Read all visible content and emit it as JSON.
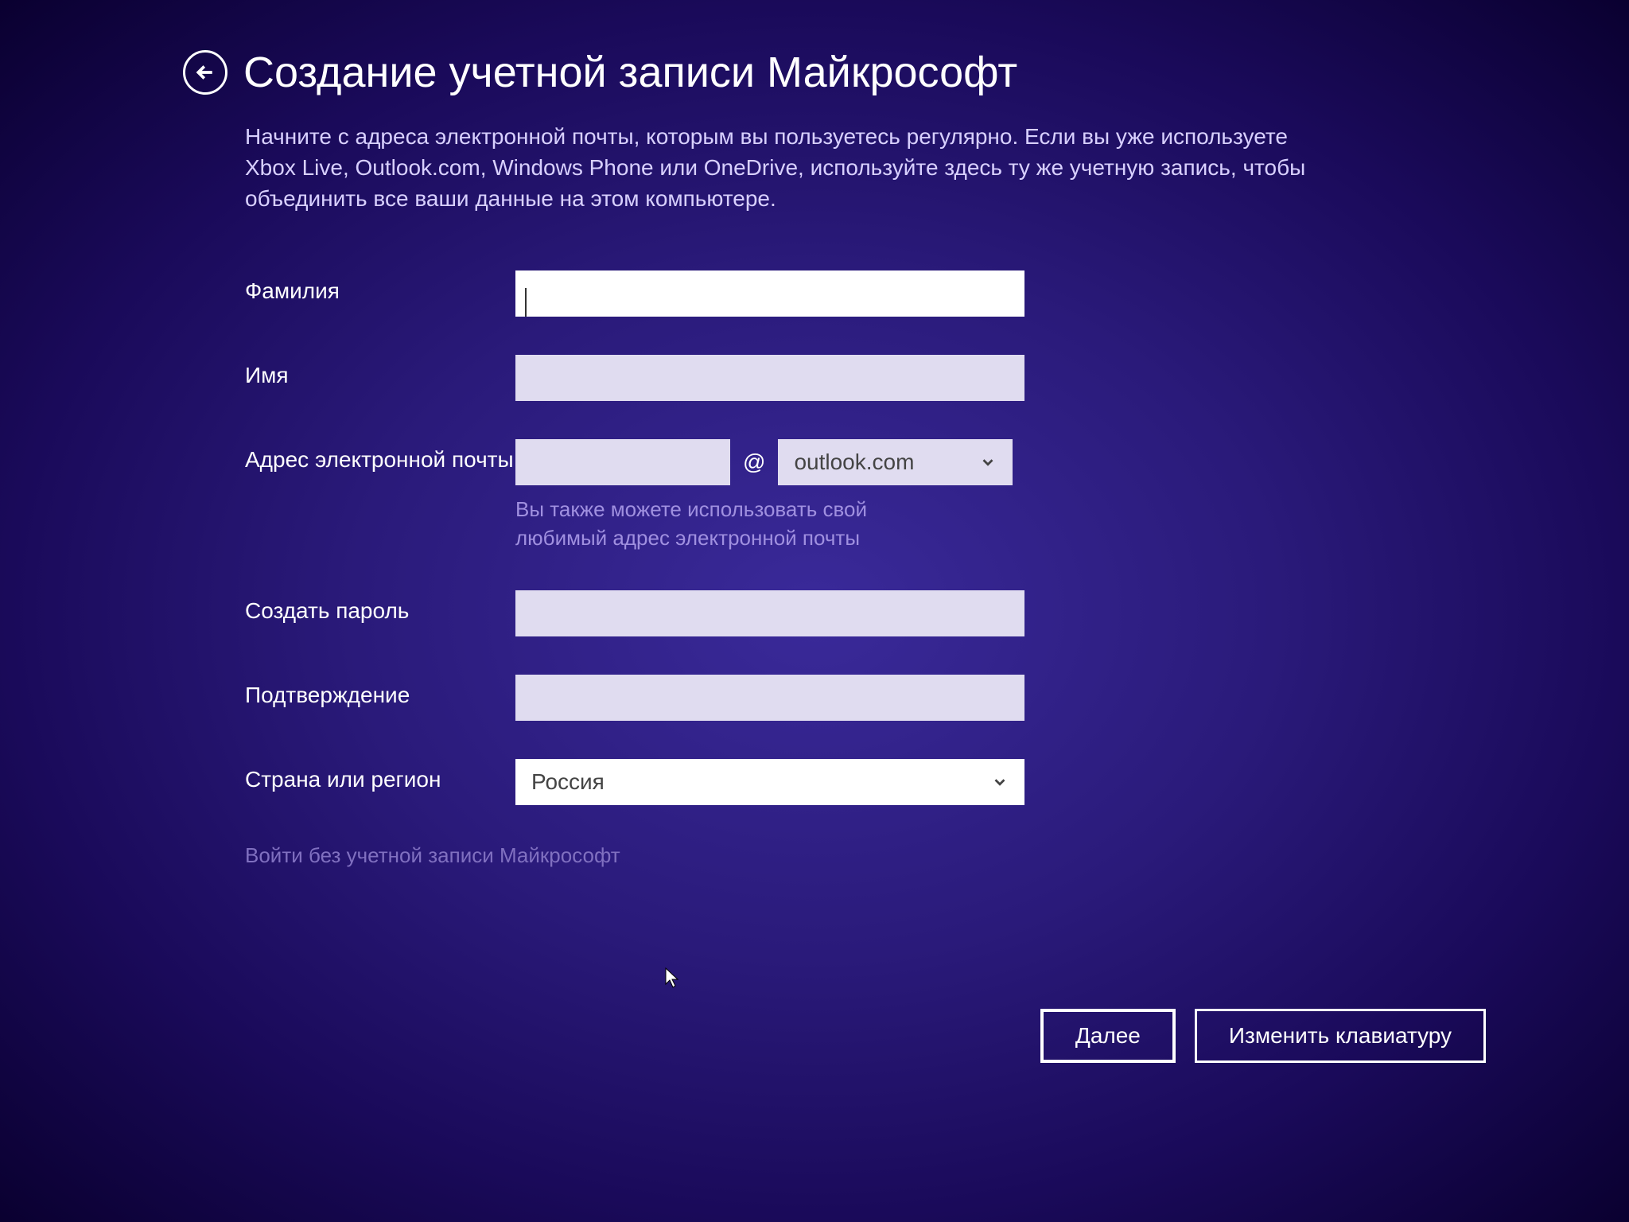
{
  "header": {
    "title": "Создание учетной записи Майкрософт"
  },
  "description": "Начните с адреса электронной почты, которым вы пользуетесь регулярно. Если вы уже используете Xbox Live, Outlook.com, Windows Phone или OneDrive, используйте здесь ту же учетную запись, чтобы объединить все ваши данные на этом компьютере.",
  "form": {
    "lastname": {
      "label": "Фамилия",
      "value": ""
    },
    "firstname": {
      "label": "Имя",
      "value": ""
    },
    "email": {
      "label": "Адрес электронной почты",
      "local_value": "",
      "at": "@",
      "domain_selected": "outlook.com",
      "helper": "Вы также можете использовать свой любимый адрес электронной почты"
    },
    "password": {
      "label": "Создать пароль",
      "value": ""
    },
    "confirm": {
      "label": "Подтверждение",
      "value": ""
    },
    "country": {
      "label": "Страна или регион",
      "selected": "Россия"
    }
  },
  "links": {
    "signin_without": "Войти без учетной записи Майкрософт"
  },
  "buttons": {
    "next": "Далее",
    "change_keyboard": "Изменить клавиатуру"
  }
}
